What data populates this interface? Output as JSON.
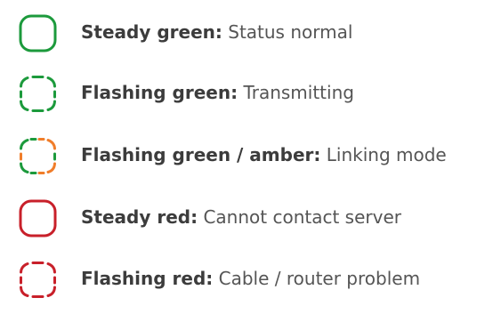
{
  "legend": {
    "items": [
      {
        "label": "Steady green:",
        "description": "Status normal",
        "icon": "steady-green-light-icon",
        "style": "solid",
        "colors": [
          "#1c9a3c"
        ]
      },
      {
        "label": "Flashing green:",
        "description": "Transmitting",
        "icon": "flashing-green-light-icon",
        "style": "dashed",
        "colors": [
          "#1c9a3c"
        ]
      },
      {
        "label": "Flashing green / amber:",
        "description": "Linking mode",
        "icon": "flashing-green-amber-light-icon",
        "style": "dashed",
        "colors": [
          "#1c9a3c",
          "#f07d2a"
        ]
      },
      {
        "label": "Steady red:",
        "description": "Cannot contact server",
        "icon": "steady-red-light-icon",
        "style": "solid",
        "colors": [
          "#c8202a"
        ]
      },
      {
        "label": "Flashing red:",
        "description": "Cable / router problem",
        "icon": "flashing-red-light-icon",
        "style": "dashed",
        "colors": [
          "#c8202a"
        ]
      }
    ]
  }
}
